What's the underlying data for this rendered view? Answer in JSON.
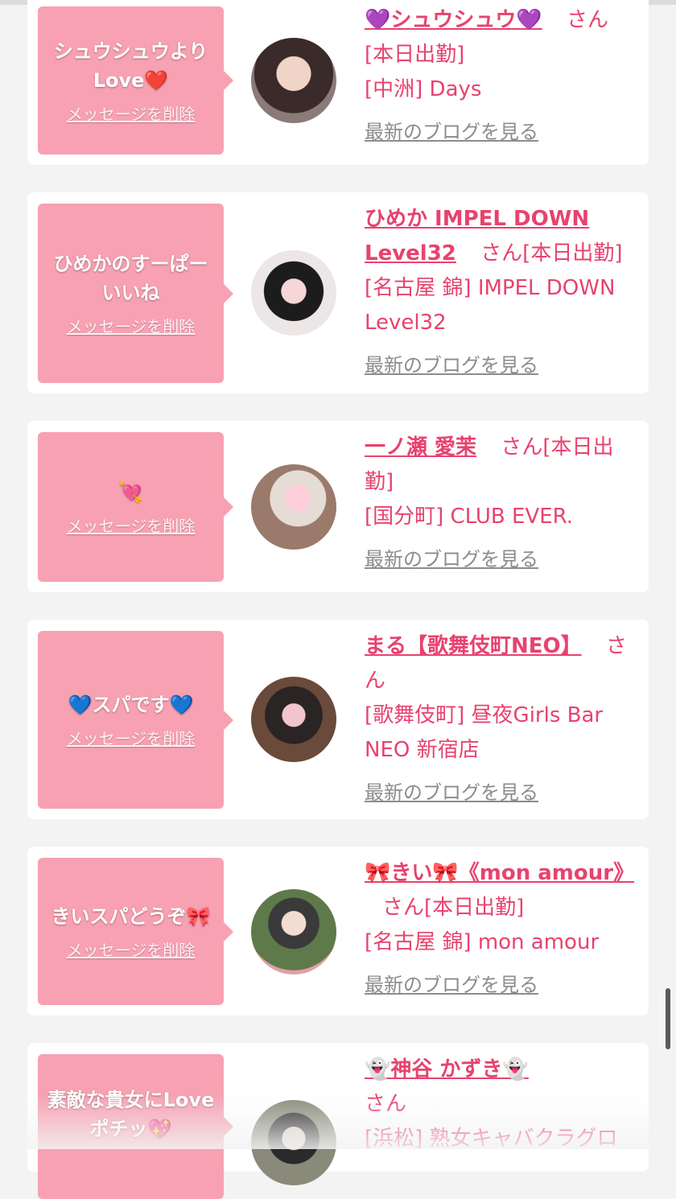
{
  "cards": [
    {
      "message": "シュウシュウより\nLove❤️",
      "delete_label": "メッセージを削除",
      "name": "💜シュウシュウ💜",
      "san": "さん",
      "status": "[本日出勤]",
      "shop": "[中洲] Days",
      "blog_label": "最新のブログを見る"
    },
    {
      "message": "ひめかのすーぱー\nいいね",
      "delete_label": "メッセージを削除",
      "name": "ひめか IMPEL DOWN Level32",
      "san": "さん",
      "status": "[本日出勤]",
      "shop": "[名古屋 錦] IMPEL DOWN Level32",
      "blog_label": "最新のブログを見る"
    },
    {
      "message": "💘",
      "delete_label": "メッセージを削除",
      "name": "一ノ瀬 愛茉",
      "san": "さん",
      "status": "[本日出勤]",
      "shop": "[国分町] CLUB EVER.",
      "blog_label": "最新のブログを見る"
    },
    {
      "message": "💙スパです💙",
      "delete_label": "メッセージを削除",
      "name": "まる【歌舞伎町NEO】",
      "san": "さん",
      "status": "",
      "shop": "[歌舞伎町] 昼夜Girls Bar NEO 新宿店",
      "blog_label": "最新のブログを見る"
    },
    {
      "message": "きいスパどうぞ🎀",
      "delete_label": "メッセージを削除",
      "name": "🎀きい🎀《mon amour》",
      "san": "さん",
      "status": "[本日出勤]",
      "shop": "[名古屋 錦] mon amour",
      "blog_label": "最新のブログを見る"
    },
    {
      "message": "素敵な貴女にLove\nポチッ💖",
      "delete_label": "",
      "name": "👻神谷 かずき👻",
      "san": "さん",
      "status": "",
      "shop": "[浜松] 熟女キャバクラグロ",
      "blog_label": ""
    }
  ],
  "colors": {
    "accent": "#e8426e",
    "bubble": "#f7a1b2",
    "link_gray": "#8c8c8c",
    "page_bg": "#f3f3f3"
  }
}
